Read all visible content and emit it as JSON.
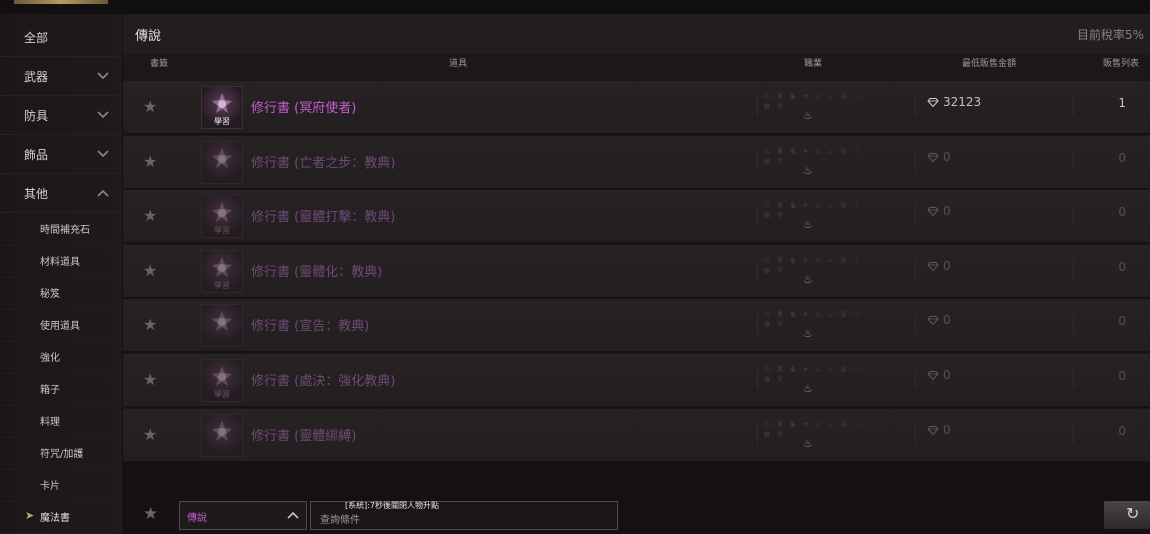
{
  "sidebar": {
    "categories": [
      {
        "label": "全部"
      },
      {
        "label": "武器"
      },
      {
        "label": "防具"
      },
      {
        "label": "飾品"
      },
      {
        "label": "其他"
      }
    ],
    "subcategories": [
      {
        "label": "時間補充石"
      },
      {
        "label": "材料道具"
      },
      {
        "label": "秘笈"
      },
      {
        "label": "使用道具"
      },
      {
        "label": "強化"
      },
      {
        "label": "箱子"
      },
      {
        "label": "料理"
      },
      {
        "label": "符咒/加護"
      },
      {
        "label": "卡片"
      },
      {
        "label": "魔法書"
      }
    ]
  },
  "header": {
    "title": "傳說",
    "tax": "目前稅率5%"
  },
  "columns": {
    "bookmark": "書籤",
    "item": "道具",
    "class": "職業",
    "min_price": "最低販售金額",
    "listings": "販售列表"
  },
  "rows": [
    {
      "name": "修行書 (冥府使者)",
      "learn": "學習",
      "price": "32123",
      "count": "1"
    },
    {
      "name": "修行書 (亡者之步：教典)",
      "learn": "",
      "price": "0",
      "count": "0"
    },
    {
      "name": "修行書 (靈體打擊：教典)",
      "learn": "學習",
      "price": "0",
      "count": "0"
    },
    {
      "name": "修行書 (靈體化：教典)",
      "learn": "學習",
      "price": "0",
      "count": "0"
    },
    {
      "name": "修行書 (宣告：教典)",
      "learn": "",
      "price": "0",
      "count": "0"
    },
    {
      "name": "修行書 (處決：強化教典)",
      "learn": "學習",
      "price": "0",
      "count": "0"
    },
    {
      "name": "修行書 (靈體綁縛)",
      "learn": "",
      "price": "0",
      "count": "0"
    }
  ],
  "bottom": {
    "grade_value": "傳說",
    "system_message": "[系統]:7秒後關閉人物升點",
    "search_placeholder": "查詢條件"
  },
  "colors": {
    "legendary": "#c35ed0",
    "accent_gold": "#c0a56e"
  }
}
